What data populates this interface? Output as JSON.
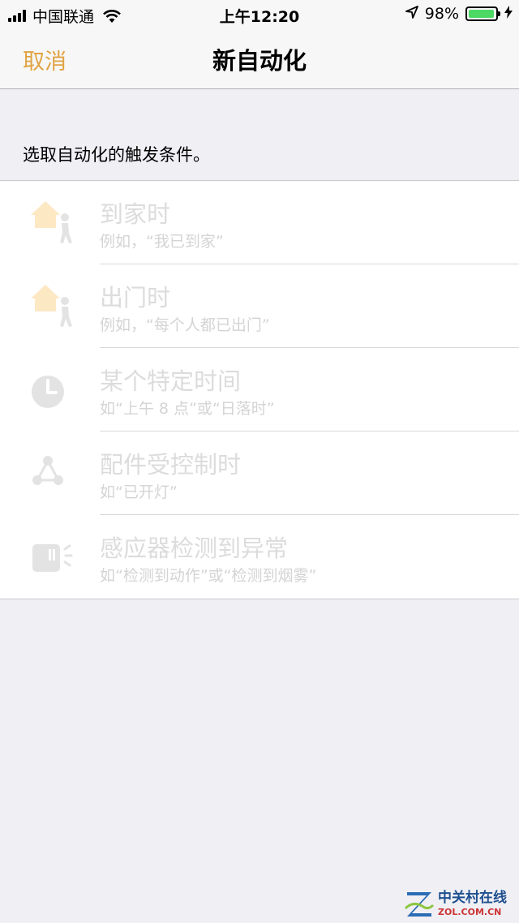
{
  "status_bar": {
    "carrier": "中国联通",
    "time": "上午12:20",
    "battery": "98%",
    "battery_level": 0.98
  },
  "nav": {
    "cancel": "取消",
    "title": "新自动化"
  },
  "section_header": "选取自动化的触发条件。",
  "triggers": [
    {
      "title": "到家时",
      "subtitle": "例如，“我已到家”",
      "icon": "house-person-icon"
    },
    {
      "title": "出门时",
      "subtitle": "例如，“每个人都已出门”",
      "icon": "house-person-icon"
    },
    {
      "title": "某个特定时间",
      "subtitle": "如“上午 8 点”或“日落时”",
      "icon": "clock-icon"
    },
    {
      "title": "配件受控制时",
      "subtitle": "如“已开灯”",
      "icon": "accessory-network-icon"
    },
    {
      "title": "感应器检测到异常",
      "subtitle": "如“检测到动作”或“检测到烟雾”",
      "icon": "sensor-icon"
    }
  ],
  "watermark": {
    "cn": "中关村在线",
    "en": "ZOL.COM.CN"
  },
  "colors": {
    "accent": "#e0a342",
    "house": "#fde8c4",
    "icon_gray": "#e3e3e3"
  }
}
